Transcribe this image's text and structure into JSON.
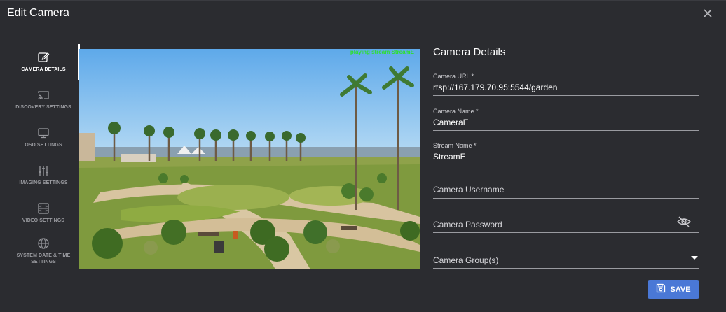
{
  "dialog": {
    "title": "Edit Camera"
  },
  "sidebar": {
    "items": [
      {
        "label": "CAMERA DETAILS",
        "icon": "edit-icon",
        "active": true
      },
      {
        "label": "DISCOVERY SETTINGS",
        "icon": "cast-icon",
        "active": false
      },
      {
        "label": "OSD SETTINGS",
        "icon": "monitor-icon",
        "active": false
      },
      {
        "label": "IMAGING SETTINGS",
        "icon": "sliders-icon",
        "active": false
      },
      {
        "label": "VIDEO SETTINGS",
        "icon": "film-icon",
        "active": false
      },
      {
        "label": "SYSTEM DATE & TIME SETTINGS",
        "icon": "globe-icon",
        "active": false
      }
    ]
  },
  "video": {
    "overlay": "playing stream StreamE"
  },
  "form": {
    "title": "Camera Details",
    "camera_url": {
      "label": "Camera URL *",
      "value": "rtsp://167.179.70.95:5544/garden"
    },
    "camera_name": {
      "label": "Camera Name *",
      "value": "CameraE"
    },
    "stream_name": {
      "label": "Stream Name *",
      "value": "StreamE"
    },
    "username": {
      "placeholder": "Camera Username"
    },
    "password": {
      "placeholder": "Camera Password",
      "icon": "eye-off-icon"
    },
    "group": {
      "placeholder": "Camera Group(s)",
      "icon": "dropdown-arrow-icon"
    }
  },
  "actions": {
    "save_label": "SAVE",
    "save_icon": "save-icon"
  },
  "colors": {
    "accent": "#4a78d6",
    "overlay_text": "#2de02d",
    "background": "#2b2c30"
  }
}
